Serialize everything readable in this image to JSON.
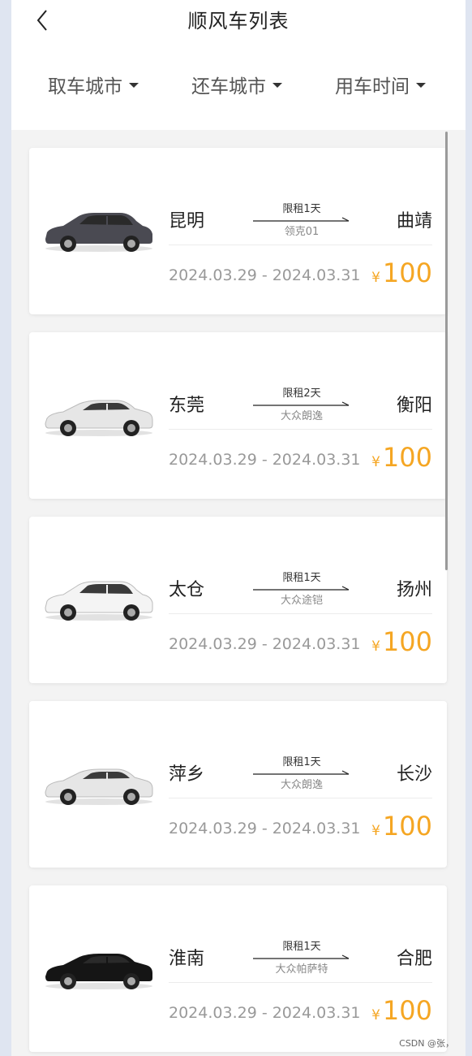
{
  "header": {
    "title": "顺风车列表",
    "back_icon": "chevron-left-icon"
  },
  "filters": [
    {
      "label": "取车城市",
      "icon": "caret-down-icon"
    },
    {
      "label": "还车城市",
      "icon": "caret-down-icon"
    },
    {
      "label": "用车时间",
      "icon": "caret-down-icon"
    }
  ],
  "rides": [
    {
      "from": "昆明",
      "to": "曲靖",
      "days": "限租1天",
      "model": "领克01",
      "dates": "2024.03.29 - 2024.03.31",
      "currency": "¥",
      "price": "100",
      "car_color": "#4a4a52"
    },
    {
      "from": "东莞",
      "to": "衡阳",
      "days": "限租2天",
      "model": "大众朗逸",
      "dates": "2024.03.29 - 2024.03.31",
      "currency": "¥",
      "price": "100",
      "car_color": "#e6e6e6"
    },
    {
      "from": "太仓",
      "to": "扬州",
      "days": "限租1天",
      "model": "大众途铠",
      "dates": "2024.03.29 - 2024.03.31",
      "currency": "¥",
      "price": "100",
      "car_color": "#f4f4f4"
    },
    {
      "from": "萍乡",
      "to": "长沙",
      "days": "限租1天",
      "model": "大众朗逸",
      "dates": "2024.03.29 - 2024.03.31",
      "currency": "¥",
      "price": "100",
      "car_color": "#e6e6e6"
    },
    {
      "from": "淮南",
      "to": "合肥",
      "days": "限租1天",
      "model": "大众帕萨特",
      "dates": "2024.03.29 - 2024.03.31",
      "currency": "¥",
      "price": "100",
      "car_color": "#151515"
    }
  ],
  "colors": {
    "accent": "#f5a623",
    "background": "#f3f3f3"
  },
  "watermark": "CSDN @张，"
}
